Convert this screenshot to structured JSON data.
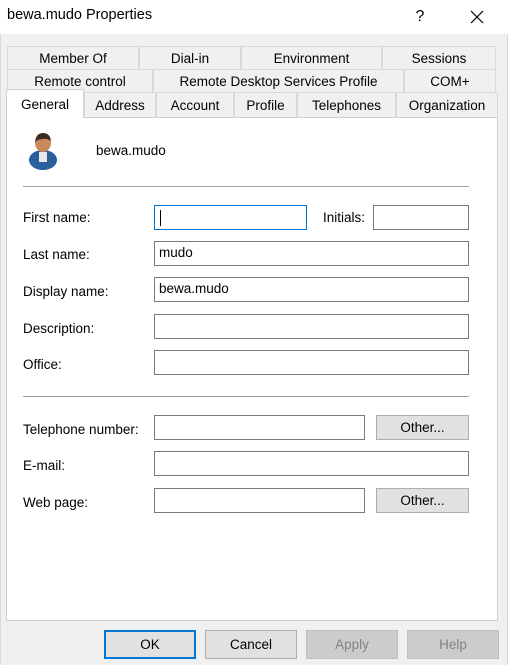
{
  "window": {
    "title": "bewa.mudo Properties",
    "help_glyph": "?",
    "close_icon": "close-icon"
  },
  "tabs": {
    "row1": [
      "Member Of",
      "Dial-in",
      "Environment",
      "Sessions"
    ],
    "row2": [
      "Remote control",
      "Remote Desktop Services Profile",
      "COM+"
    ],
    "row3": [
      "General",
      "Address",
      "Account",
      "Profile",
      "Telephones",
      "Organization"
    ],
    "active": "General"
  },
  "general": {
    "user_icon": "user-icon",
    "display_name_header": "bewa.mudo",
    "first_name_label": "First name:",
    "first_name_value": "",
    "initials_label": "Initials:",
    "initials_value": "",
    "last_name_label": "Last name:",
    "last_name_value": "mudo",
    "display_name_label": "Display name:",
    "display_name_value": "bewa.mudo",
    "description_label": "Description:",
    "description_value": "",
    "office_label": "Office:",
    "office_value": "",
    "telephone_label": "Telephone number:",
    "telephone_value": "",
    "telephone_other": "Other...",
    "email_label": "E-mail:",
    "email_value": "",
    "webpage_label": "Web page:",
    "webpage_value": "",
    "webpage_other": "Other..."
  },
  "buttons": {
    "ok": "OK",
    "cancel": "Cancel",
    "apply": "Apply",
    "help": "Help"
  },
  "colors": {
    "focus_accent": "#0078d7",
    "dialog_bg": "#f0f0f0",
    "disabled_text": "#838383"
  }
}
